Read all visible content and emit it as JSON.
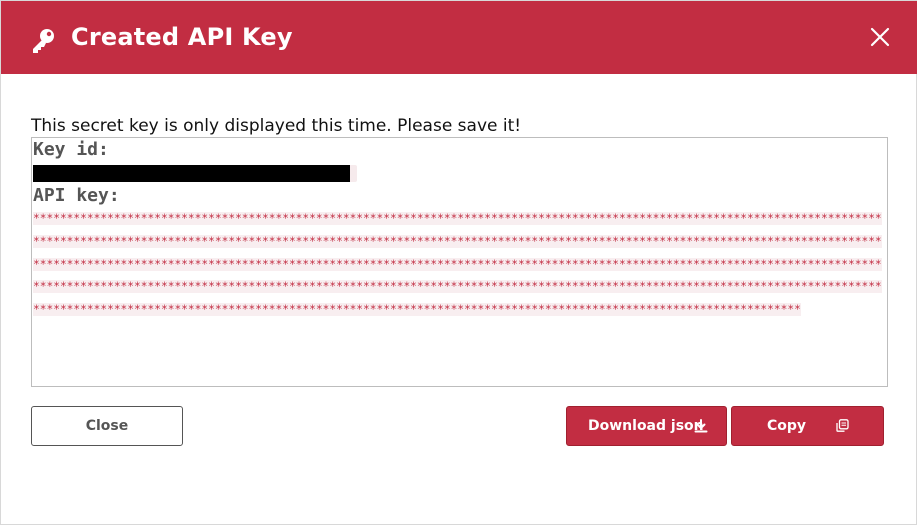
{
  "dialog": {
    "title": "Created API Key",
    "icon": "key-icon",
    "close_icon": "close-icon"
  },
  "message": "This secret key is only displayed this time. Please save it!",
  "key_box": {
    "key_id_label": "Key id:",
    "key_id_value_state": "redacted",
    "api_key_label": "API key:",
    "api_key_value": "******************************************************************************************************************************************************************************************************************************************************************************************************************************************************************************************************************************************************************************************************************************************************************************************************************************************"
  },
  "buttons": {
    "close_label": "Close",
    "download_label": "Download json",
    "download_icon": "download-icon",
    "copy_label": "Copy",
    "copy_icon": "copy-icon"
  },
  "colors": {
    "brand": "#c22d42",
    "button_border": "#555555",
    "text": "#111111"
  }
}
